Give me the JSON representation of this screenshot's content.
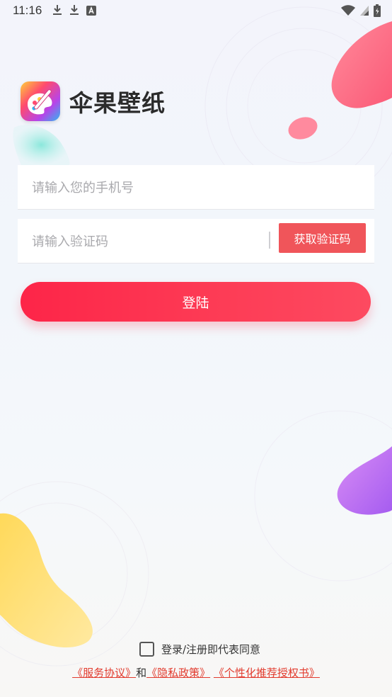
{
  "status_bar": {
    "time": "11:16",
    "left_icons": [
      "download-icon",
      "download-icon",
      "font-icon"
    ],
    "right_icons": [
      "wifi-icon",
      "signal-icon",
      "battery-icon"
    ]
  },
  "app": {
    "name": "伞果壁纸",
    "icon": "palette-icon"
  },
  "form": {
    "phone_placeholder": "请输入您的手机号",
    "phone_value": "",
    "code_placeholder": "请输入验证码",
    "code_value": "",
    "get_code_label": "获取验证码",
    "login_label": "登陆"
  },
  "agreement": {
    "checked": false,
    "text": "登录/注册即代表同意",
    "service_link": "《服务协议》",
    "conjunction": "和",
    "privacy_link": "《隐私政策》",
    "personalized_link": "《个性化推荐授权书》"
  },
  "colors": {
    "accent": "#fd2548",
    "get_code_bg": "#f0555a",
    "link": "#e23b2e"
  }
}
